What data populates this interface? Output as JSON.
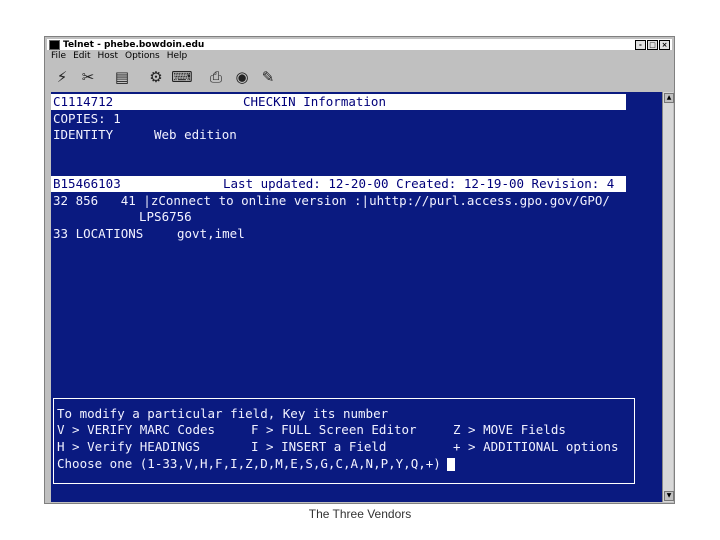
{
  "window": {
    "title": "Telnet - phebe.bowdoin.edu",
    "controls": [
      "-",
      "□",
      "×"
    ]
  },
  "menu": [
    "File",
    "Edit",
    "Host",
    "Options",
    "Help"
  ],
  "toolbar_icons": [
    "connect-icon",
    "disconnect-icon",
    "terminal-icon",
    "settings-icon",
    "keyboard-icon",
    "print-icon",
    "network-icon",
    "tools-icon"
  ],
  "terminal": {
    "record1": {
      "id": "C1114712",
      "title": "CHECKIN Information",
      "copies": "COPIES: 1",
      "identity_label": "IDENTITY",
      "identity_value": "Web edition"
    },
    "record2": {
      "id": "B15466103",
      "meta": "Last updated: 12-20-00 Created: 12-19-00 Revision: 4",
      "line1": "32 856   41 |zConnect to online version :|uhttp://purl.access.gpo.gov/GPO/",
      "line2": "LPS6756",
      "locations_label": "33 LOCATIONS",
      "locations_value": "govt,imel"
    },
    "commands": {
      "intro": "To modify a particular field, Key its number",
      "v": "V > VERIFY MARC Codes",
      "f": "F > FULL Screen Editor",
      "z": "Z > MOVE Fields",
      "h": "H > Verify HEADINGS",
      "i": "I > INSERT a Field",
      "plus": "+ > ADDITIONAL options",
      "prompt": "Choose one (1-33,V,H,F,I,Z,D,M,E,S,G,C,A,N,P,Y,Q,+)"
    }
  },
  "caption": "The Three Vendors"
}
